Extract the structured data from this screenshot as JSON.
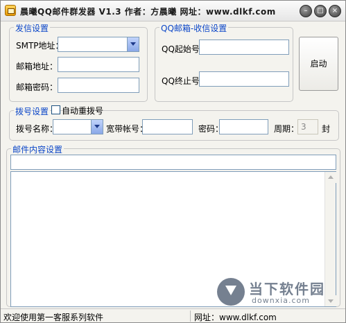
{
  "window": {
    "title": "晨曦QQ邮件群发器 V1.3    作者：方晨曦   网址：www.dlkf.com",
    "min_label": "–",
    "max_label": "□",
    "close_label": "×"
  },
  "send_settings": {
    "legend": "发信设置",
    "smtp_label": "SMTP地址：",
    "smtp_value": "",
    "email_label": "邮箱地址：",
    "email_value": "",
    "password_label": "邮箱密码：",
    "password_value": ""
  },
  "receive_settings": {
    "legend": "QQ邮箱-收信设置",
    "start_label": "QQ起始号：",
    "start_value": "",
    "end_label": "QQ终止号：",
    "end_value": ""
  },
  "start_button": {
    "label": "启动"
  },
  "dial_settings": {
    "legend": "拨号设置",
    "auto_redial_label": "自动重拨号",
    "auto_redial_checked": false,
    "dial_name_label": "拨号名称：",
    "dial_name_value": "",
    "broadband_label": "宽带帐号：",
    "broadband_value": "",
    "password_label": "密码：",
    "password_value": "",
    "period_label": "周期：",
    "period_value": "3",
    "period_unit": "封"
  },
  "content_settings": {
    "legend": "邮件内容设置",
    "subject_value": "",
    "body_value": ""
  },
  "status": {
    "left": "欢迎使用第一客服系列软件",
    "right": "网址：www.dlkf.com"
  },
  "watermark": {
    "title": "当下软件园",
    "url": "downxia.com"
  }
}
